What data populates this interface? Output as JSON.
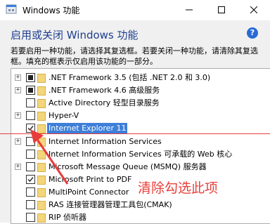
{
  "window": {
    "title": "Windows 功能",
    "controls": {
      "minimize": "minimize",
      "maximize": "maximize",
      "close": "close"
    }
  },
  "heading": "启用或关闭 Windows 功能",
  "help": {
    "glyph": "?"
  },
  "description": "若要启用一种功能，请选择其复选框。若要关闭一种功能，请清除其复选框。填充的框表示仅启用该功能的一部分。",
  "features": [
    {
      "label": ".NET Framework 3.5 (包括 .NET 2.0 和 3.0)",
      "expandable": true,
      "state": "partial",
      "selected": false
    },
    {
      "label": ".NET Framework 4.6 高级服务",
      "expandable": true,
      "state": "partial",
      "selected": false
    },
    {
      "label": "Active Directory 轻型目录服务",
      "expandable": false,
      "state": "unchecked",
      "selected": false
    },
    {
      "label": "Hyper-V",
      "expandable": true,
      "state": "unchecked",
      "selected": false
    },
    {
      "label": "Internet Explorer 11",
      "expandable": false,
      "state": "checked",
      "selected": true
    },
    {
      "label": "Internet Information Services",
      "expandable": true,
      "state": "unchecked",
      "selected": false
    },
    {
      "label": "Internet Information Services 可承载的 Web 核心",
      "expandable": false,
      "state": "unchecked",
      "selected": false
    },
    {
      "label": "Microsoft Message Queue (MSMQ) 服务器",
      "expandable": true,
      "state": "unchecked",
      "selected": false
    },
    {
      "label": "Microsoft Print to PDF",
      "expandable": false,
      "state": "checked",
      "selected": false
    },
    {
      "label": "MultiPoint Connector",
      "expandable": false,
      "state": "unchecked",
      "selected": false
    },
    {
      "label": "RAS 连接管理器管理工具包(CMAK)",
      "expandable": false,
      "state": "unchecked",
      "selected": false
    },
    {
      "label": "RIP 侦听器",
      "expandable": false,
      "state": "unchecked",
      "selected": false
    }
  ],
  "annotation": {
    "text": "清除勾选此项",
    "color": "#e8403b"
  },
  "colors": {
    "heading": "#1e3f8f",
    "selection": "#3d7fd9",
    "folder": "#f3d57b",
    "panel": "#f0f0f0"
  }
}
